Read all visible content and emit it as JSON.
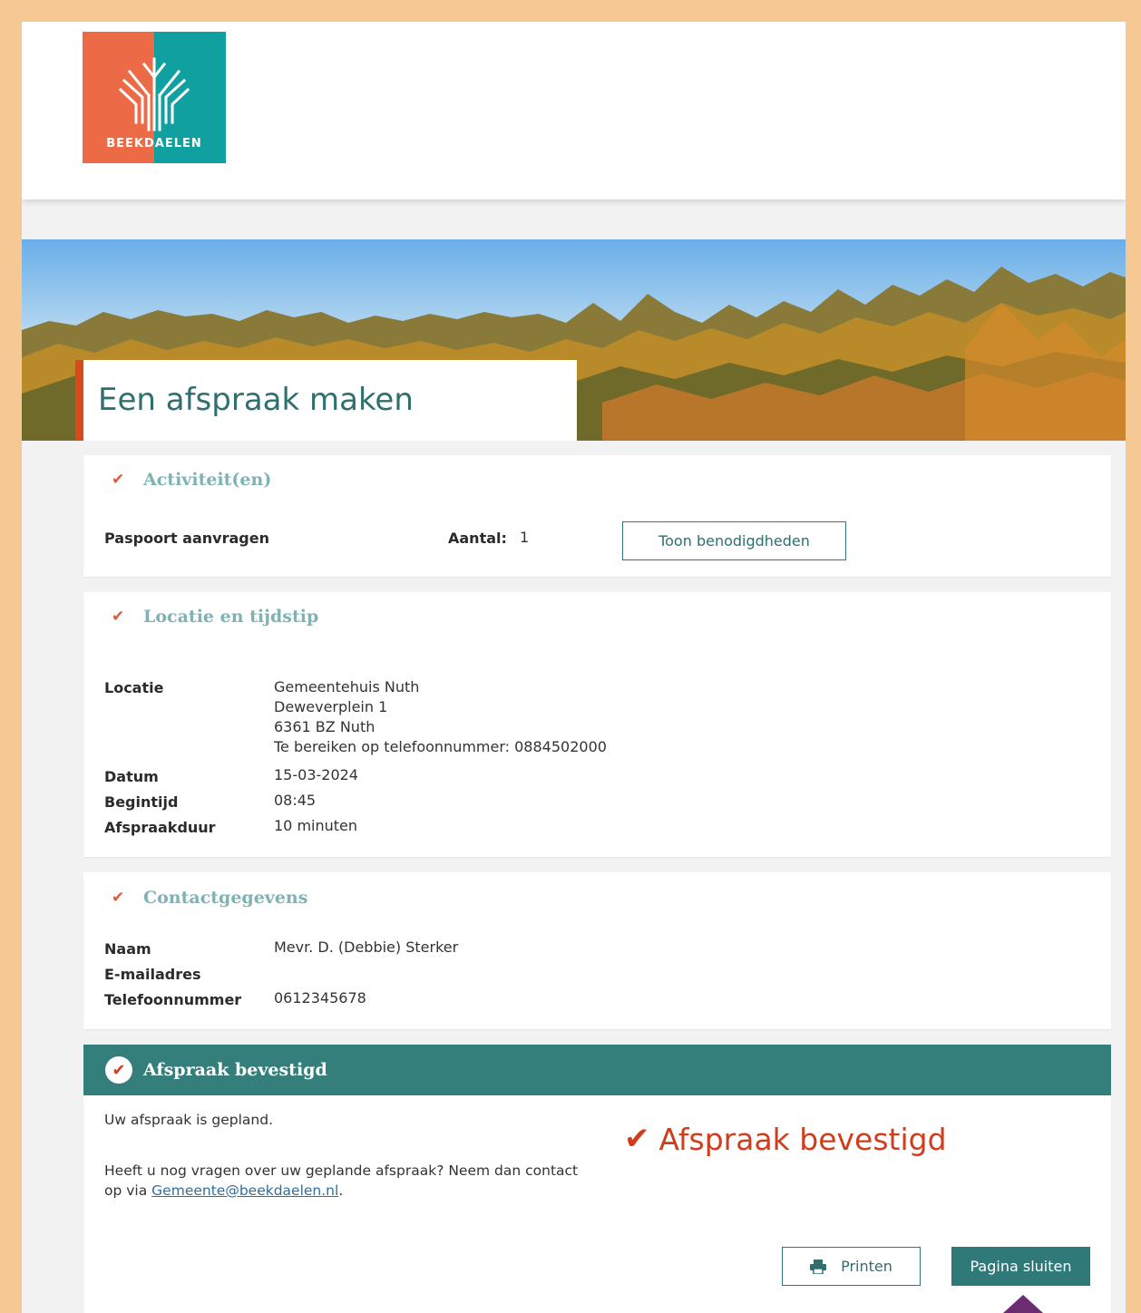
{
  "logo": {
    "text": "BEEKDAELEN"
  },
  "page": {
    "title": "Een afspraak maken"
  },
  "activities": {
    "heading": "Activiteit(en)",
    "item": "Paspoort aanvragen",
    "count_label": "Aantal:",
    "count_value": "1",
    "show_button": "Toon benodigdheden"
  },
  "location": {
    "heading": "Locatie en tijdstip",
    "location_label": "Locatie",
    "location_lines": [
      "Gemeentehuis Nuth",
      "Deweverplein 1",
      "6361 BZ Nuth",
      "Te bereiken op telefoonnummer: 0884502000"
    ],
    "date_label": "Datum",
    "date_value": "15-03-2024",
    "start_label": "Begintijd",
    "start_value": "08:45",
    "duration_label": "Afspraakduur",
    "duration_value": "10 minuten"
  },
  "contact": {
    "heading": "Contactgegevens",
    "name_label": "Naam",
    "name_value": "Mevr. D. (Debbie) Sterker",
    "email_label": "E-mailadres",
    "email_value": "",
    "phone_label": "Telefoonnummer",
    "phone_value": "0612345678"
  },
  "confirmation": {
    "bar_title": "Afspraak bevestigd",
    "planned_text": "Uw afspraak is gepland.",
    "question_text_1": "Heeft u nog vragen over uw geplande afspraak? Neem dan contact",
    "question_text_2": "op via",
    "email_link": "Gemeente@beekdaelen.nl",
    "period": ".",
    "big_text": "Afspraak bevestigd",
    "print_button": "Printen",
    "close_button": "Pagina sluiten"
  },
  "colors": {
    "teal": "#347e7c",
    "orange_accent": "#d84a1b",
    "frame": "#f6c994"
  },
  "icons": [
    "check-icon",
    "check-circle-icon",
    "printer-icon",
    "tree-logo-icon"
  ]
}
